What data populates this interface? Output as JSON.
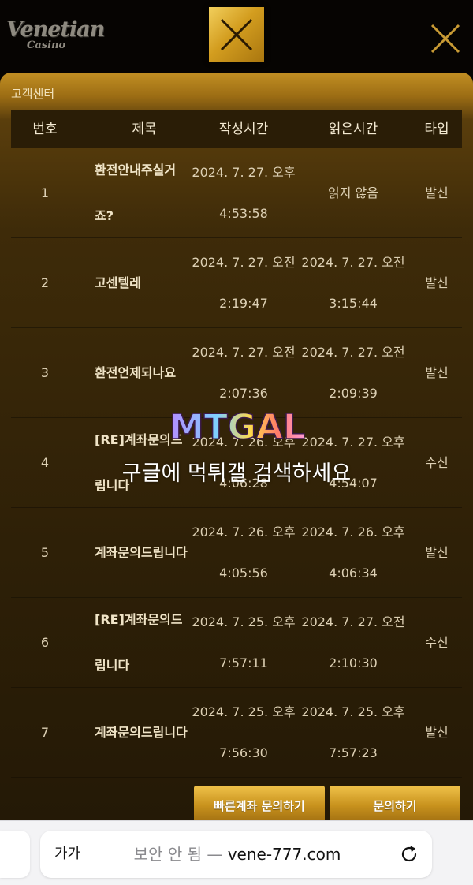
{
  "header": {
    "logo_main": "Venetian",
    "logo_sub": "Casino"
  },
  "panel": {
    "title": "고객센터",
    "columns": [
      "번호",
      "제목",
      "작성시간",
      "읽은시간",
      "타입"
    ],
    "rows": [
      {
        "num": "1",
        "title": "환전안내주실거죠?",
        "written": [
          "2024. 7. 27. 오후",
          "4:53:58"
        ],
        "read": [
          "읽지 않음"
        ],
        "type": "발신"
      },
      {
        "num": "2",
        "title": "고센텔레",
        "written": [
          "2024. 7. 27. 오전",
          "2:19:47"
        ],
        "read": [
          "2024. 7. 27. 오전",
          "3:15:44"
        ],
        "type": "발신"
      },
      {
        "num": "3",
        "title": "환전언제되나요",
        "written": [
          "2024. 7. 27. 오전",
          "2:07:36"
        ],
        "read": [
          "2024. 7. 27. 오전",
          "2:09:39"
        ],
        "type": "발신"
      },
      {
        "num": "4",
        "title": "[RE]계좌문의드립니다",
        "written": [
          "2024. 7. 26. 오후",
          "4:06:28"
        ],
        "read": [
          "2024. 7. 27. 오후",
          "4:54:07"
        ],
        "type": "수신"
      },
      {
        "num": "5",
        "title": "계좌문의드립니다",
        "written": [
          "2024. 7. 26. 오후",
          "4:05:56"
        ],
        "read": [
          "2024. 7. 26. 오후",
          "4:06:34"
        ],
        "type": "발신"
      },
      {
        "num": "6",
        "title": "[RE]계좌문의드립니다",
        "written": [
          "2024. 7. 25. 오후",
          "7:57:11"
        ],
        "read": [
          "2024. 7. 27. 오전",
          "2:10:30"
        ],
        "type": "수신"
      },
      {
        "num": "7",
        "title": "계좌문의드립니다",
        "written": [
          "2024. 7. 25. 오후",
          "7:56:30"
        ],
        "read": [
          "2024. 7. 25. 오후",
          "7:57:23"
        ],
        "type": "발신"
      }
    ]
  },
  "buttons": {
    "quick_account": "빠른계좌 문의하기",
    "inquire": "문의하기"
  },
  "watermark": {
    "logo_text": "MTGAL",
    "text": "구글에 먹튀갤 검색하세요"
  },
  "browser": {
    "text_size": "가가",
    "insecure_label": "보안 안 됨 —",
    "domain": "vene-777.com"
  },
  "colors": {
    "gold": "#c8921d",
    "panel_dark": "#2a1d06"
  }
}
